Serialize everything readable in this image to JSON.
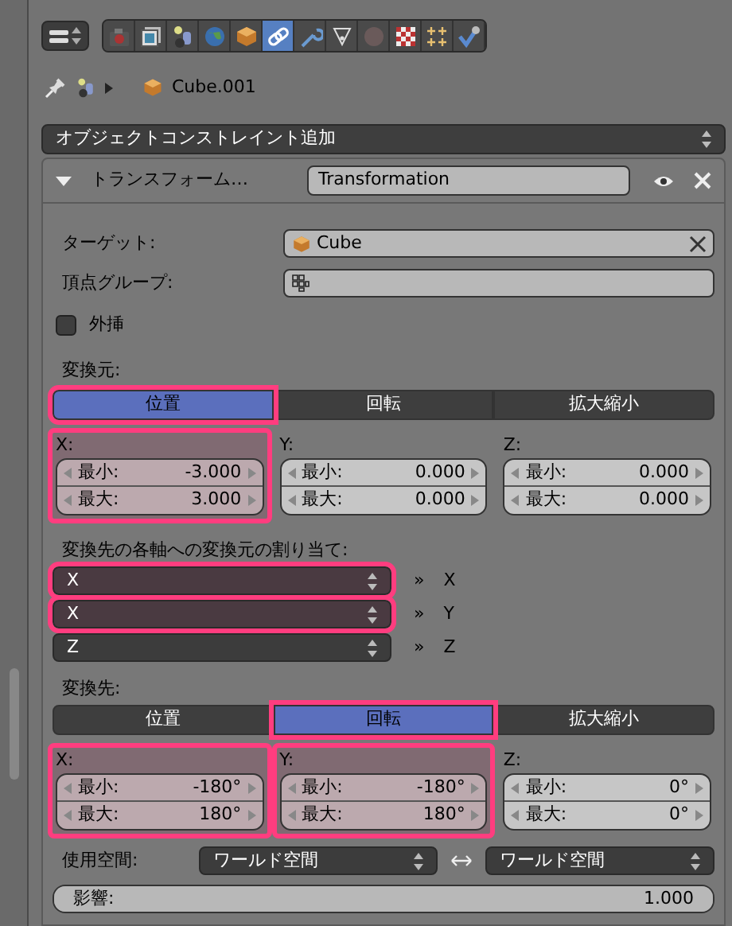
{
  "property_tabs": [
    {
      "selected": false
    },
    {
      "selected": false
    },
    {
      "selected": false
    },
    {
      "selected": false
    },
    {
      "selected": false
    },
    {
      "selected": true
    },
    {
      "selected": false
    },
    {
      "selected": false
    },
    {
      "selected": false
    },
    {
      "selected": false
    },
    {
      "selected": false
    },
    {
      "selected": false
    }
  ],
  "breadcrumb": {
    "object": "Cube.001"
  },
  "add_constraint": {
    "label": "オブジェクトコンストレイント追加"
  },
  "constraint": {
    "expanded": true,
    "type_label": "トランスフォーム…",
    "name": "Transformation",
    "target": {
      "label": "ターゲット:",
      "value": "Cube"
    },
    "vertex_group": {
      "label": "頂点グループ:"
    },
    "extrapolate": {
      "label": "外挿",
      "checked": false
    },
    "source": {
      "label": "変換元:",
      "tabs": [
        {
          "label": "位置",
          "selected": true,
          "highlighted": true
        },
        {
          "label": "回転",
          "selected": false,
          "highlighted": false
        },
        {
          "label": "拡大縮小",
          "selected": false,
          "highlighted": false
        }
      ],
      "axes": [
        {
          "label": "X:",
          "highlighted": true,
          "min_label": "最小:",
          "min": "-3.000",
          "max_label": "最大:",
          "max": "3.000"
        },
        {
          "label": "Y:",
          "highlighted": false,
          "min_label": "最小:",
          "min": "0.000",
          "max_label": "最大:",
          "max": "0.000"
        },
        {
          "label": "Z:",
          "highlighted": false,
          "min_label": "最小:",
          "min": "0.000",
          "max_label": "最大:",
          "max": "0.000"
        }
      ]
    },
    "mapping": {
      "label": "変換先の各軸への変換元の割り当て:",
      "rows": [
        {
          "source": "X",
          "arrow": "»",
          "target": "X",
          "highlighted": true
        },
        {
          "source": "X",
          "arrow": "»",
          "target": "Y",
          "highlighted": true
        },
        {
          "source": "Z",
          "arrow": "»",
          "target": "Z",
          "highlighted": false
        }
      ]
    },
    "destination": {
      "label": "変換先:",
      "tabs": [
        {
          "label": "位置",
          "selected": false,
          "highlighted": false
        },
        {
          "label": "回転",
          "selected": true,
          "highlighted": true
        },
        {
          "label": "拡大縮小",
          "selected": false,
          "highlighted": false
        }
      ],
      "axes": [
        {
          "label": "X:",
          "highlighted": true,
          "min_label": "最小:",
          "min": "-180°",
          "max_label": "最大:",
          "max": "180°"
        },
        {
          "label": "Y:",
          "highlighted": true,
          "min_label": "最小:",
          "min": "-180°",
          "max_label": "最大:",
          "max": "180°"
        },
        {
          "label": "Z:",
          "highlighted": false,
          "min_label": "最小:",
          "min": "0°",
          "max_label": "最大:",
          "max": "0°"
        }
      ]
    },
    "space": {
      "label": "使用空間:",
      "owner": "ワールド空間",
      "target": "ワールド空間"
    },
    "influence": {
      "label": "影響:",
      "value": "1.000",
      "level": 1
    }
  }
}
